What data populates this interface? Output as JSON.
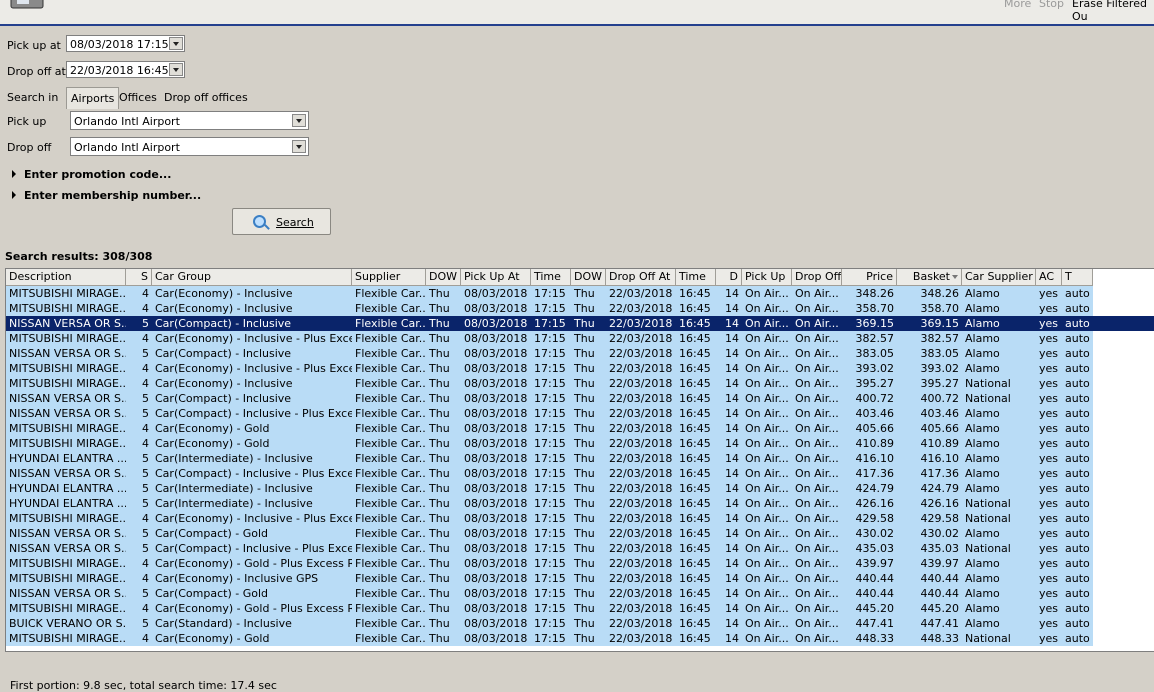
{
  "toolbar": {
    "more": "More",
    "stop": "Stop",
    "erase": "Erase Filtered Ou"
  },
  "form": {
    "pickup_at_label": "Pick up at",
    "pickup_at_value": "08/03/2018 17:15",
    "dropoff_at_label": "Drop off at",
    "dropoff_at_value": "22/03/2018 16:45",
    "search_in_label": "Search in",
    "tabs": [
      {
        "label": "Airports"
      },
      {
        "label": "Offices"
      },
      {
        "label": "Drop off offices"
      }
    ],
    "pickup_label": "Pick up",
    "pickup_value": "Orlando Intl Airport",
    "dropoff_label": "Drop off",
    "dropoff_value": "Orlando Intl Airport",
    "promo_label": "Enter promotion code...",
    "membership_label": "Enter membership number...",
    "search_button": "Search"
  },
  "results": {
    "title": "Search results: 308/308",
    "columns": [
      "Description",
      "S",
      "Car Group",
      "Supplier",
      "DOW",
      "Pick Up At",
      "Time",
      "DOW",
      "Drop Off At",
      "Time",
      "D",
      "Pick Up",
      "Drop Off",
      "Price",
      "Basket",
      "Car Supplier",
      "AC",
      "T"
    ],
    "selected_row": 2,
    "rows": [
      [
        "MITSUBISHI MIRAGE...",
        "4",
        "Car(Economy) - Inclusive",
        "Flexible Car...",
        "Thu",
        "08/03/2018",
        "17:15",
        "Thu",
        "22/03/2018",
        "16:45",
        "14",
        "On Air...",
        "On Air...",
        "348.26",
        "348.26",
        "Alamo",
        "yes",
        "auto"
      ],
      [
        "MITSUBISHI MIRAGE...",
        "4",
        "Car(Economy) - Inclusive",
        "Flexible Car...",
        "Thu",
        "08/03/2018",
        "17:15",
        "Thu",
        "22/03/2018",
        "16:45",
        "14",
        "On Air...",
        "On Air...",
        "358.70",
        "358.70",
        "Alamo",
        "yes",
        "auto"
      ],
      [
        "NISSAN VERSA OR S...",
        "5",
        "Car(Compact) - Inclusive",
        "Flexible Car...",
        "Thu",
        "08/03/2018",
        "17:15",
        "Thu",
        "22/03/2018",
        "16:45",
        "14",
        "On Air...",
        "On Air...",
        "369.15",
        "369.15",
        "Alamo",
        "yes",
        "auto"
      ],
      [
        "MITSUBISHI MIRAGE...",
        "4",
        "Car(Economy) - Inclusive - Plus Exces...",
        "Flexible Car...",
        "Thu",
        "08/03/2018",
        "17:15",
        "Thu",
        "22/03/2018",
        "16:45",
        "14",
        "On Air...",
        "On Air...",
        "382.57",
        "382.57",
        "Alamo",
        "yes",
        "auto"
      ],
      [
        "NISSAN VERSA OR S...",
        "5",
        "Car(Compact) - Inclusive",
        "Flexible Car...",
        "Thu",
        "08/03/2018",
        "17:15",
        "Thu",
        "22/03/2018",
        "16:45",
        "14",
        "On Air...",
        "On Air...",
        "383.05",
        "383.05",
        "Alamo",
        "yes",
        "auto"
      ],
      [
        "MITSUBISHI MIRAGE...",
        "4",
        "Car(Economy) - Inclusive - Plus Exces...",
        "Flexible Car...",
        "Thu",
        "08/03/2018",
        "17:15",
        "Thu",
        "22/03/2018",
        "16:45",
        "14",
        "On Air...",
        "On Air...",
        "393.02",
        "393.02",
        "Alamo",
        "yes",
        "auto"
      ],
      [
        "MITSUBISHI MIRAGE...",
        "4",
        "Car(Economy) - Inclusive",
        "Flexible Car...",
        "Thu",
        "08/03/2018",
        "17:15",
        "Thu",
        "22/03/2018",
        "16:45",
        "14",
        "On Air...",
        "On Air...",
        "395.27",
        "395.27",
        "National",
        "yes",
        "auto"
      ],
      [
        "NISSAN VERSA OR S...",
        "5",
        "Car(Compact) - Inclusive",
        "Flexible Car...",
        "Thu",
        "08/03/2018",
        "17:15",
        "Thu",
        "22/03/2018",
        "16:45",
        "14",
        "On Air...",
        "On Air...",
        "400.72",
        "400.72",
        "National",
        "yes",
        "auto"
      ],
      [
        "NISSAN VERSA OR S...",
        "5",
        "Car(Compact) - Inclusive - Plus Exces...",
        "Flexible Car...",
        "Thu",
        "08/03/2018",
        "17:15",
        "Thu",
        "22/03/2018",
        "16:45",
        "14",
        "On Air...",
        "On Air...",
        "403.46",
        "403.46",
        "Alamo",
        "yes",
        "auto"
      ],
      [
        "MITSUBISHI MIRAGE...",
        "4",
        "Car(Economy) - Gold",
        "Flexible Car...",
        "Thu",
        "08/03/2018",
        "17:15",
        "Thu",
        "22/03/2018",
        "16:45",
        "14",
        "On Air...",
        "On Air...",
        "405.66",
        "405.66",
        "Alamo",
        "yes",
        "auto"
      ],
      [
        "MITSUBISHI MIRAGE...",
        "4",
        "Car(Economy) - Gold",
        "Flexible Car...",
        "Thu",
        "08/03/2018",
        "17:15",
        "Thu",
        "22/03/2018",
        "16:45",
        "14",
        "On Air...",
        "On Air...",
        "410.89",
        "410.89",
        "Alamo",
        "yes",
        "auto"
      ],
      [
        "HYUNDAI ELANTRA ...",
        "5",
        "Car(Intermediate) - Inclusive",
        "Flexible Car...",
        "Thu",
        "08/03/2018",
        "17:15",
        "Thu",
        "22/03/2018",
        "16:45",
        "14",
        "On Air...",
        "On Air...",
        "416.10",
        "416.10",
        "Alamo",
        "yes",
        "auto"
      ],
      [
        "NISSAN VERSA OR S...",
        "5",
        "Car(Compact) - Inclusive - Plus Exces...",
        "Flexible Car...",
        "Thu",
        "08/03/2018",
        "17:15",
        "Thu",
        "22/03/2018",
        "16:45",
        "14",
        "On Air...",
        "On Air...",
        "417.36",
        "417.36",
        "Alamo",
        "yes",
        "auto"
      ],
      [
        "HYUNDAI ELANTRA ...",
        "5",
        "Car(Intermediate) - Inclusive",
        "Flexible Car...",
        "Thu",
        "08/03/2018",
        "17:15",
        "Thu",
        "22/03/2018",
        "16:45",
        "14",
        "On Air...",
        "On Air...",
        "424.79",
        "424.79",
        "Alamo",
        "yes",
        "auto"
      ],
      [
        "HYUNDAI ELANTRA ...",
        "5",
        "Car(Intermediate) - Inclusive",
        "Flexible Car...",
        "Thu",
        "08/03/2018",
        "17:15",
        "Thu",
        "22/03/2018",
        "16:45",
        "14",
        "On Air...",
        "On Air...",
        "426.16",
        "426.16",
        "National",
        "yes",
        "auto"
      ],
      [
        "MITSUBISHI MIRAGE...",
        "4",
        "Car(Economy) - Inclusive - Plus Exces...",
        "Flexible Car...",
        "Thu",
        "08/03/2018",
        "17:15",
        "Thu",
        "22/03/2018",
        "16:45",
        "14",
        "On Air...",
        "On Air...",
        "429.58",
        "429.58",
        "National",
        "yes",
        "auto"
      ],
      [
        "NISSAN VERSA OR S...",
        "5",
        "Car(Compact) - Gold",
        "Flexible Car...",
        "Thu",
        "08/03/2018",
        "17:15",
        "Thu",
        "22/03/2018",
        "16:45",
        "14",
        "On Air...",
        "On Air...",
        "430.02",
        "430.02",
        "Alamo",
        "yes",
        "auto"
      ],
      [
        "NISSAN VERSA OR S...",
        "5",
        "Car(Compact) - Inclusive - Plus Exces...",
        "Flexible Car...",
        "Thu",
        "08/03/2018",
        "17:15",
        "Thu",
        "22/03/2018",
        "16:45",
        "14",
        "On Air...",
        "On Air...",
        "435.03",
        "435.03",
        "National",
        "yes",
        "auto"
      ],
      [
        "MITSUBISHI MIRAGE...",
        "4",
        "Car(Economy) - Gold - Plus Excess Re...",
        "Flexible Car...",
        "Thu",
        "08/03/2018",
        "17:15",
        "Thu",
        "22/03/2018",
        "16:45",
        "14",
        "On Air...",
        "On Air...",
        "439.97",
        "439.97",
        "Alamo",
        "yes",
        "auto"
      ],
      [
        "MITSUBISHI MIRAGE...",
        "4",
        "Car(Economy) - Inclusive GPS",
        "Flexible Car...",
        "Thu",
        "08/03/2018",
        "17:15",
        "Thu",
        "22/03/2018",
        "16:45",
        "14",
        "On Air...",
        "On Air...",
        "440.44",
        "440.44",
        "Alamo",
        "yes",
        "auto"
      ],
      [
        "NISSAN VERSA OR S...",
        "5",
        "Car(Compact) - Gold",
        "Flexible Car...",
        "Thu",
        "08/03/2018",
        "17:15",
        "Thu",
        "22/03/2018",
        "16:45",
        "14",
        "On Air...",
        "On Air...",
        "440.44",
        "440.44",
        "Alamo",
        "yes",
        "auto"
      ],
      [
        "MITSUBISHI MIRAGE...",
        "4",
        "Car(Economy) - Gold - Plus Excess Re...",
        "Flexible Car...",
        "Thu",
        "08/03/2018",
        "17:15",
        "Thu",
        "22/03/2018",
        "16:45",
        "14",
        "On Air...",
        "On Air...",
        "445.20",
        "445.20",
        "Alamo",
        "yes",
        "auto"
      ],
      [
        "BUICK VERANO OR S...",
        "5",
        "Car(Standard) - Inclusive",
        "Flexible Car...",
        "Thu",
        "08/03/2018",
        "17:15",
        "Thu",
        "22/03/2018",
        "16:45",
        "14",
        "On Air...",
        "On Air...",
        "447.41",
        "447.41",
        "Alamo",
        "yes",
        "auto"
      ],
      [
        "MITSUBISHI MIRAGE...",
        "4",
        "Car(Economy) - Gold",
        "Flexible Car...",
        "Thu",
        "08/03/2018",
        "17:15",
        "Thu",
        "22/03/2018",
        "16:45",
        "14",
        "On Air...",
        "On Air...",
        "448.33",
        "448.33",
        "National",
        "yes",
        "auto"
      ]
    ]
  },
  "status": "First portion: 9.8 sec, total search time: 17.4 sec",
  "colors": {
    "selected_row_bg": "#0a246a",
    "row_bg": "#b9dcf6",
    "window_bg": "#d4d0c8",
    "title_line": "#24408e"
  }
}
